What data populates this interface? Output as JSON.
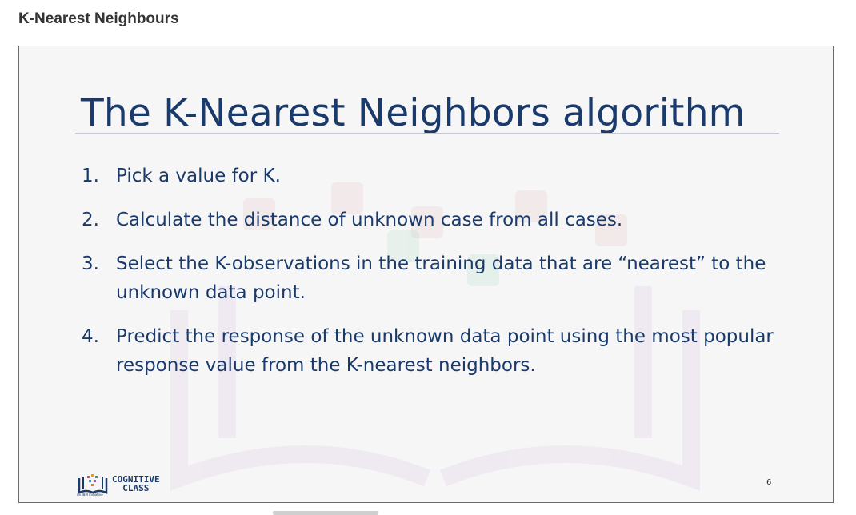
{
  "page": {
    "heading": "K-Nearest Neighbours"
  },
  "slide": {
    "title": "The K-Nearest Neighbors algorithm",
    "steps": [
      {
        "num": "1.",
        "text": "Pick a value for K."
      },
      {
        "num": "2.",
        "text": "Calculate the distance of unknown case from all cases."
      },
      {
        "num": "3.",
        "text": "Select the K-observations in the training data that are “nearest” to the unknown data point."
      },
      {
        "num": "4.",
        "text": "Predict the response of the unknown data point using the most popular response value from the K-nearest neighbors."
      }
    ],
    "logo": {
      "line1": "COGNITIVE",
      "line2": "CLASS",
      "sub": "An IBM Initiative"
    },
    "page_number": "6"
  },
  "colors": {
    "text_navy": "#1a3a6b",
    "heading": "#333333",
    "frame_border": "#6b6b6b"
  }
}
